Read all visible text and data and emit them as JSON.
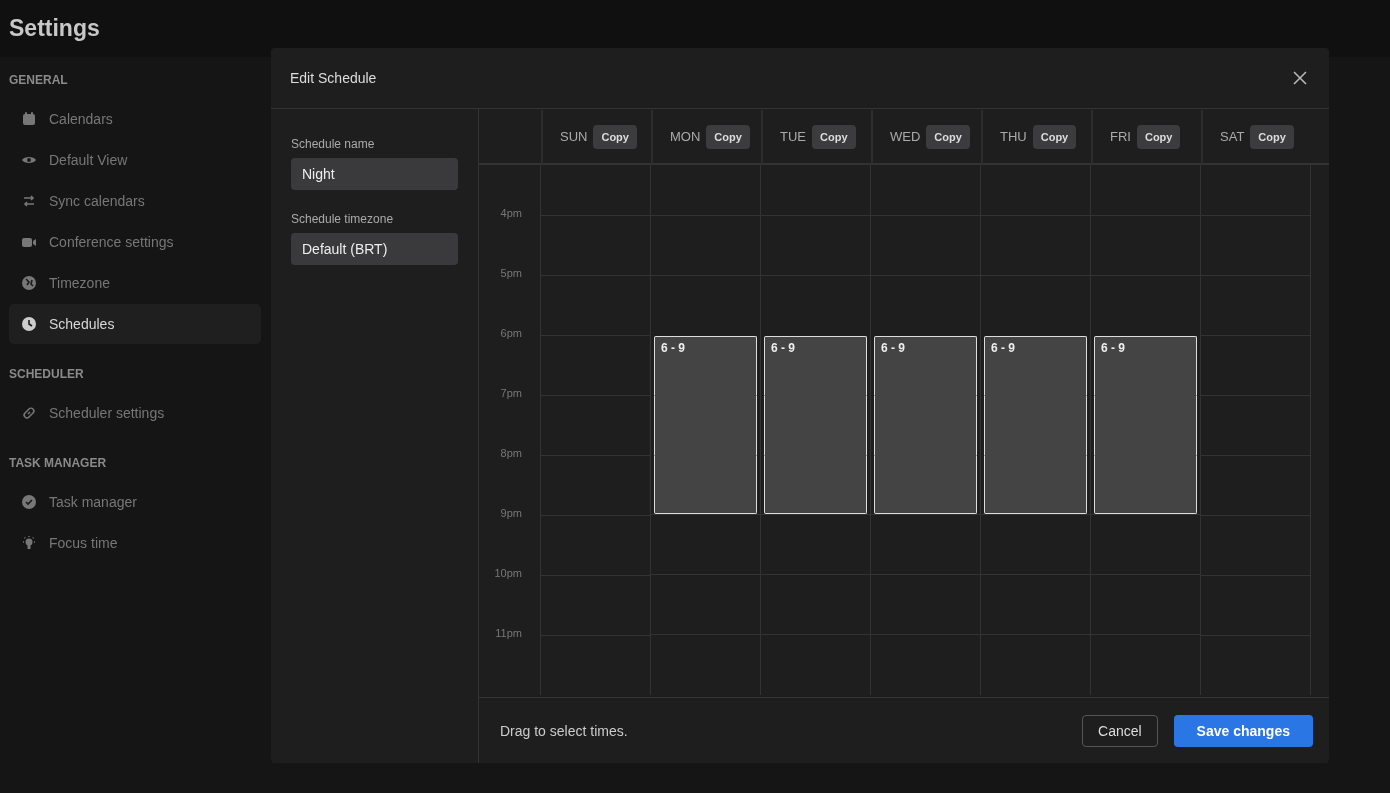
{
  "page_title": "Settings",
  "sidebar": {
    "sections": [
      {
        "heading": "GENERAL",
        "items": [
          {
            "label": "Calendars",
            "selected": false
          },
          {
            "label": "Default View",
            "selected": false
          },
          {
            "label": "Sync calendars",
            "selected": false
          },
          {
            "label": "Conference settings",
            "selected": false
          },
          {
            "label": "Timezone",
            "selected": false
          },
          {
            "label": "Schedules",
            "selected": true
          }
        ]
      },
      {
        "heading": "SCHEDULER",
        "items": [
          {
            "label": "Scheduler settings",
            "selected": false
          }
        ]
      },
      {
        "heading": "TASK MANAGER",
        "items": [
          {
            "label": "Task manager",
            "selected": false
          },
          {
            "label": "Focus time",
            "selected": false
          }
        ]
      }
    ]
  },
  "dialog": {
    "title": "Edit Schedule",
    "fields": [
      {
        "label": "Schedule name",
        "value": "Night"
      },
      {
        "label": "Schedule timezone",
        "value": "Default (BRT)"
      }
    ],
    "time_labels": [
      "4pm",
      "5pm",
      "6pm",
      "7pm",
      "8pm",
      "9pm",
      "10pm",
      "11pm"
    ],
    "days": [
      {
        "label": "SUN",
        "copy": "Copy",
        "slots": [
          false,
          false,
          false,
          false,
          false,
          false,
          false,
          false
        ]
      },
      {
        "label": "MON",
        "copy": "Copy",
        "block_label": "6 - 9",
        "slots": [
          false,
          false,
          true,
          true,
          true,
          false,
          false,
          false
        ]
      },
      {
        "label": "TUE",
        "copy": "Copy",
        "block_label": "6 - 9",
        "slots": [
          false,
          false,
          true,
          true,
          true,
          false,
          false,
          false
        ]
      },
      {
        "label": "WED",
        "copy": "Copy",
        "block_label": "6 - 9",
        "slots": [
          false,
          false,
          true,
          true,
          true,
          false,
          false,
          false
        ]
      },
      {
        "label": "THU",
        "copy": "Copy",
        "block_label": "6 - 9",
        "slots": [
          false,
          false,
          true,
          true,
          true,
          false,
          false,
          false
        ]
      },
      {
        "label": "FRI",
        "copy": "Copy",
        "block_label": "6 - 9",
        "slots": [
          false,
          false,
          true,
          true,
          true,
          false,
          false,
          false
        ]
      },
      {
        "label": "SAT",
        "copy": "Copy",
        "slots": [
          false,
          false,
          false,
          false,
          false,
          false,
          false,
          false
        ]
      }
    ],
    "hint": "Drag to select times.",
    "buttons": [
      {
        "label": "Cancel",
        "kind": "secondary"
      },
      {
        "label": "Save changes",
        "kind": "primary"
      }
    ]
  }
}
